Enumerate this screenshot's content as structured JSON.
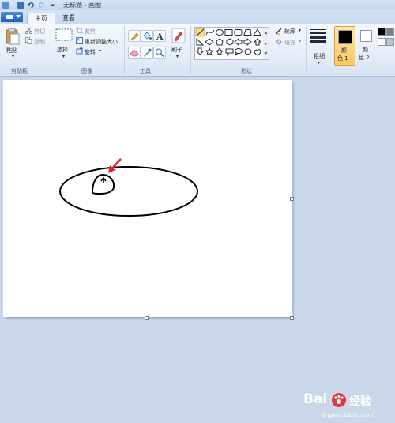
{
  "window": {
    "title": "无标题 - 画图"
  },
  "tabs": [
    {
      "label": "主页"
    },
    {
      "label": "查看"
    }
  ],
  "clipboard": {
    "paste": "粘贴",
    "cut": "剪切",
    "copy": "复制",
    "group": "剪贴板"
  },
  "image": {
    "select": "选择",
    "crop": "裁剪",
    "resize": "重新调整大小",
    "rotate": "旋转",
    "group": "图像"
  },
  "tools": {
    "group": "工具"
  },
  "brushes": {
    "label": "刷子"
  },
  "shapes": {
    "outline": "轮廓",
    "fill": "填充",
    "group": "形状"
  },
  "size": {
    "label": "粗细"
  },
  "colors": {
    "color1": "颜色 1",
    "color1_line1": "颜",
    "color1_line2": "色 1",
    "color2_line1": "颜",
    "color2_line2": "色 2",
    "color1_value": "#000000",
    "color2_value": "#ffffff",
    "palette": [
      "#000000",
      "#ffffff",
      "#7f7f7f",
      "#c3c3c3"
    ]
  },
  "watermark": {
    "brand": "Bai",
    "brand2": "经验",
    "sub": "jingyan.baidu.com"
  },
  "icons": [
    "save-icon",
    "undo-icon",
    "redo-icon",
    "paste-icon",
    "scissors-icon",
    "copy-icon",
    "select-icon",
    "crop-icon",
    "resize-icon",
    "rotate-icon",
    "pencil-icon",
    "fill-icon",
    "text-icon",
    "eraser-icon",
    "color-picker-icon",
    "magnifier-icon",
    "brush-icon",
    "size-lines-icon",
    "arrow-pointer-icon",
    "paw-icon"
  ],
  "accent": "#f5a623",
  "arrow_color": "#e0202a"
}
